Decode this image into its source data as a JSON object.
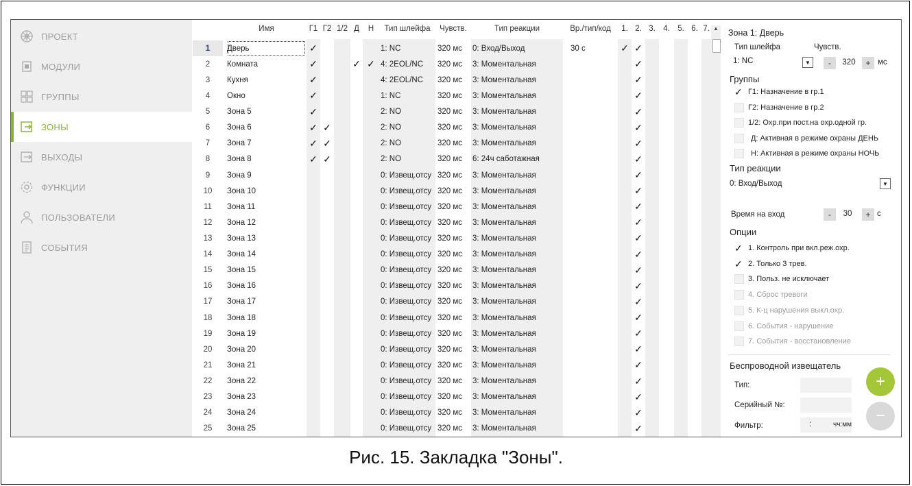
{
  "caption": "Рис. 15. Закладка \"Зоны\".",
  "sidebar": {
    "items": [
      {
        "label": "ПРОЕКТ",
        "icon": "project-icon"
      },
      {
        "label": "МОДУЛИ",
        "icon": "modules-icon"
      },
      {
        "label": "ГРУППЫ",
        "icon": "groups-icon"
      },
      {
        "label": "ЗОНЫ",
        "icon": "zones-icon",
        "active": true
      },
      {
        "label": "ВЫХОДЫ",
        "icon": "outputs-icon"
      },
      {
        "label": "ФУНКЦИИ",
        "icon": "functions-icon"
      },
      {
        "label": "ПОЛЬЗОВАТЕЛИ",
        "icon": "users-icon"
      },
      {
        "label": "СОБЫТИЯ",
        "icon": "events-icon"
      }
    ]
  },
  "table": {
    "headers": {
      "name": "Имя",
      "g1": "Г1",
      "g2": "Г2",
      "g12": "1/2",
      "d": "Д",
      "n": "Н",
      "loop": "Тип шлейфа",
      "sens": "Чувств.",
      "reaction": "Тип реакции",
      "time": "Вр./тип/код",
      "o1": "1.",
      "o2": "2.",
      "o3": "3.",
      "o4": "4.",
      "o5": "5.",
      "o6": "6.",
      "o7": "7."
    },
    "check_mark": "✓",
    "rows": [
      {
        "num": "1",
        "name": "Дверь",
        "g1": true,
        "g2": false,
        "d": false,
        "n": false,
        "loop": "1: NC",
        "sens": "320 мс",
        "reaction": "0: Вход/Выход",
        "time": "30 с",
        "o1": true,
        "o2": true
      },
      {
        "num": "2",
        "name": "Комната",
        "g1": true,
        "g2": false,
        "d": true,
        "n": true,
        "loop": "4: 2EOL/NC",
        "sens": "320 мс",
        "reaction": "3: Моментальная",
        "time": "",
        "o1": false,
        "o2": true
      },
      {
        "num": "3",
        "name": "Кухня",
        "g1": true,
        "g2": false,
        "d": false,
        "n": false,
        "loop": "4: 2EOL/NC",
        "sens": "320 мс",
        "reaction": "3: Моментальная",
        "time": "",
        "o1": false,
        "o2": true
      },
      {
        "num": "4",
        "name": "Окно",
        "g1": true,
        "g2": false,
        "d": false,
        "n": false,
        "loop": "1: NC",
        "sens": "320 мс",
        "reaction": "3: Моментальная",
        "time": "",
        "o1": false,
        "o2": true
      },
      {
        "num": "5",
        "name": "Зона 5",
        "g1": true,
        "g2": false,
        "d": false,
        "n": false,
        "loop": "2: NO",
        "sens": "320 мс",
        "reaction": "3: Моментальная",
        "time": "",
        "o1": false,
        "o2": true
      },
      {
        "num": "6",
        "name": "Зона 6",
        "g1": true,
        "g2": true,
        "d": false,
        "n": false,
        "loop": "2: NO",
        "sens": "320 мс",
        "reaction": "3: Моментальная",
        "time": "",
        "o1": false,
        "o2": true
      },
      {
        "num": "7",
        "name": "Зона 7",
        "g1": true,
        "g2": true,
        "d": false,
        "n": false,
        "loop": "2: NO",
        "sens": "320 мс",
        "reaction": "3: Моментальная",
        "time": "",
        "o1": false,
        "o2": true
      },
      {
        "num": "8",
        "name": "Зона 8",
        "g1": true,
        "g2": true,
        "d": false,
        "n": false,
        "loop": "2: NO",
        "sens": "320 мс",
        "reaction": "6: 24ч саботажная",
        "time": "",
        "o1": false,
        "o2": true
      },
      {
        "num": "9",
        "name": "Зона 9",
        "g1": false,
        "g2": false,
        "d": false,
        "n": false,
        "loop": "0: Извещ.отсу",
        "sens": "320 мс",
        "reaction": "3: Моментальная",
        "time": "",
        "o1": false,
        "o2": true
      },
      {
        "num": "10",
        "name": "Зона 10",
        "g1": false,
        "g2": false,
        "d": false,
        "n": false,
        "loop": "0: Извещ.отсу",
        "sens": "320 мс",
        "reaction": "3: Моментальная",
        "time": "",
        "o1": false,
        "o2": true
      },
      {
        "num": "11",
        "name": "Зона 11",
        "g1": false,
        "g2": false,
        "d": false,
        "n": false,
        "loop": "0: Извещ.отсу",
        "sens": "320 мс",
        "reaction": "3: Моментальная",
        "time": "",
        "o1": false,
        "o2": true
      },
      {
        "num": "12",
        "name": "Зона 12",
        "g1": false,
        "g2": false,
        "d": false,
        "n": false,
        "loop": "0: Извещ.отсу",
        "sens": "320 мс",
        "reaction": "3: Моментальная",
        "time": "",
        "o1": false,
        "o2": true
      },
      {
        "num": "13",
        "name": "Зона 13",
        "g1": false,
        "g2": false,
        "d": false,
        "n": false,
        "loop": "0: Извещ.отсу",
        "sens": "320 мс",
        "reaction": "3: Моментальная",
        "time": "",
        "o1": false,
        "o2": true
      },
      {
        "num": "14",
        "name": "Зона 14",
        "g1": false,
        "g2": false,
        "d": false,
        "n": false,
        "loop": "0: Извещ.отсу",
        "sens": "320 мс",
        "reaction": "3: Моментальная",
        "time": "",
        "o1": false,
        "o2": true
      },
      {
        "num": "15",
        "name": "Зона 15",
        "g1": false,
        "g2": false,
        "d": false,
        "n": false,
        "loop": "0: Извещ.отсу",
        "sens": "320 мс",
        "reaction": "3: Моментальная",
        "time": "",
        "o1": false,
        "o2": true
      },
      {
        "num": "16",
        "name": "Зона 16",
        "g1": false,
        "g2": false,
        "d": false,
        "n": false,
        "loop": "0: Извещ.отсу",
        "sens": "320 мс",
        "reaction": "3: Моментальная",
        "time": "",
        "o1": false,
        "o2": true
      },
      {
        "num": "17",
        "name": "Зона 17",
        "g1": false,
        "g2": false,
        "d": false,
        "n": false,
        "loop": "0: Извещ.отсу",
        "sens": "320 мс",
        "reaction": "3: Моментальная",
        "time": "",
        "o1": false,
        "o2": true
      },
      {
        "num": "18",
        "name": "Зона 18",
        "g1": false,
        "g2": false,
        "d": false,
        "n": false,
        "loop": "0: Извещ.отсу",
        "sens": "320 мс",
        "reaction": "3: Моментальная",
        "time": "",
        "o1": false,
        "o2": true
      },
      {
        "num": "19",
        "name": "Зона 19",
        "g1": false,
        "g2": false,
        "d": false,
        "n": false,
        "loop": "0: Извещ.отсу",
        "sens": "320 мс",
        "reaction": "3: Моментальная",
        "time": "",
        "o1": false,
        "o2": true
      },
      {
        "num": "20",
        "name": "Зона 20",
        "g1": false,
        "g2": false,
        "d": false,
        "n": false,
        "loop": "0: Извещ.отсу",
        "sens": "320 мс",
        "reaction": "3: Моментальная",
        "time": "",
        "o1": false,
        "o2": true
      },
      {
        "num": "21",
        "name": "Зона 21",
        "g1": false,
        "g2": false,
        "d": false,
        "n": false,
        "loop": "0: Извещ.отсу",
        "sens": "320 мс",
        "reaction": "3: Моментальная",
        "time": "",
        "o1": false,
        "o2": true
      },
      {
        "num": "22",
        "name": "Зона 22",
        "g1": false,
        "g2": false,
        "d": false,
        "n": false,
        "loop": "0: Извещ.отсу",
        "sens": "320 мс",
        "reaction": "3: Моментальная",
        "time": "",
        "o1": false,
        "o2": true
      },
      {
        "num": "23",
        "name": "Зона 23",
        "g1": false,
        "g2": false,
        "d": false,
        "n": false,
        "loop": "0: Извещ.отсу",
        "sens": "320 мс",
        "reaction": "3: Моментальная",
        "time": "",
        "o1": false,
        "o2": true
      },
      {
        "num": "24",
        "name": "Зона 24",
        "g1": false,
        "g2": false,
        "d": false,
        "n": false,
        "loop": "0: Извещ.отсу",
        "sens": "320 мс",
        "reaction": "3: Моментальная",
        "time": "",
        "o1": false,
        "o2": true
      },
      {
        "num": "25",
        "name": "Зона 25",
        "g1": false,
        "g2": false,
        "d": false,
        "n": false,
        "loop": "0: Извещ.отсу",
        "sens": "320 мс",
        "reaction": "3: Моментальная",
        "time": "",
        "o1": false,
        "o2": true
      }
    ]
  },
  "panel": {
    "title": "Зона 1: Дверь",
    "loop_label": "Тип шлейфа",
    "loop_value": "1: NC",
    "sens_label": "Чувств.",
    "sens_minus": "-",
    "sens_value": "320",
    "sens_plus": "+",
    "sens_unit": "мс",
    "groups_title": "Группы",
    "groups": [
      {
        "label": "Г1: Назначение в гр.1",
        "checked": true
      },
      {
        "label": "Г2: Назначение в гр.2",
        "checked": false
      },
      {
        "label": "1/2: Охр.при пост.на охр.одной гр.",
        "checked": false
      },
      {
        "label": "Д: Активная в режиме охраны ДЕНЬ",
        "checked": false
      },
      {
        "label": "Н: Активная в режиме охраны НОЧЬ",
        "checked": false
      }
    ],
    "reaction_title": "Тип реакции",
    "reaction_value": "0: Вход/Выход",
    "entry_label": "Время на вход",
    "entry_minus": "-",
    "entry_value": "30",
    "entry_plus": "+",
    "entry_unit": "с",
    "options_title": "Опции",
    "options": [
      {
        "label": "1. Контроль при вкл.реж.охр.",
        "checked": true,
        "disabled": false
      },
      {
        "label": "2. Только 3 трев.",
        "checked": true,
        "disabled": false
      },
      {
        "label": "3. Польз. не исключает",
        "checked": false,
        "disabled": false
      },
      {
        "label": "4. Сброс тревоги",
        "checked": false,
        "disabled": true
      },
      {
        "label": "5. К-ц нарушения выкл.охр.",
        "checked": false,
        "disabled": true
      },
      {
        "label": "6. События - нарушение",
        "checked": false,
        "disabled": true
      },
      {
        "label": "7. События - восстановление",
        "checked": false,
        "disabled": true
      }
    ],
    "wireless_title": "Беспроводной извещатель",
    "type_label": "Тип:",
    "serial_label": "Серийный №:",
    "filter_label": "Фильтр:",
    "filter_sep": ":",
    "filter_unit": "чч:мм",
    "add_symbol": "+",
    "remove_symbol": "−",
    "colors": {
      "accent": "#8bb33a",
      "fab_add": "#a4c639",
      "fab_remove": "#d9d9d9"
    }
  }
}
